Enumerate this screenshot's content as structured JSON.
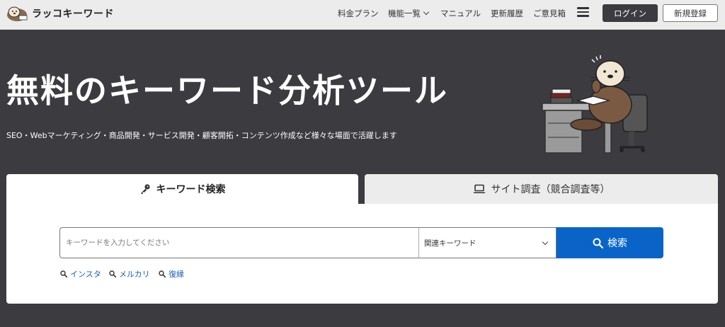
{
  "header": {
    "logo_text": "ラッコキーワード",
    "nav": [
      {
        "label": "料金プラン"
      },
      {
        "label": "機能一覧"
      },
      {
        "label": "マニュアル"
      },
      {
        "label": "更新履歴"
      },
      {
        "label": "ご意見箱"
      }
    ],
    "login_label": "ログイン",
    "register_label": "新規登録"
  },
  "hero": {
    "title": "無料のキーワード分析ツール",
    "subtitle": "SEO・Webマーケティング・商品開発・サービス開発・顧客開拓・コンテンツ作成など様々な場面で活躍します"
  },
  "tabs": [
    {
      "label": "キーワード検索",
      "icon": "key-icon",
      "active": true
    },
    {
      "label": "サイト調査（競合調査等）",
      "icon": "laptop-icon",
      "active": false
    }
  ],
  "search": {
    "placeholder": "キーワードを入力してください",
    "select_value": "関連キーワード",
    "button_label": "検索"
  },
  "suggestions": [
    "インスタ",
    "メルカリ",
    "復縁"
  ],
  "colors": {
    "primary": "#0a64c8",
    "dark": "#3b3b40",
    "link": "#1860b8"
  }
}
